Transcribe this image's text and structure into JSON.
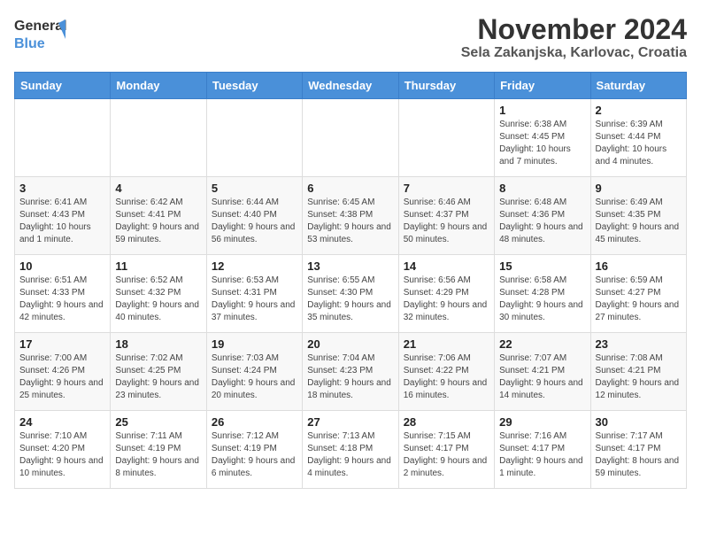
{
  "logo": {
    "general": "General",
    "blue": "Blue"
  },
  "title": "November 2024",
  "subtitle": "Sela Zakanjska, Karlovac, Croatia",
  "headers": [
    "Sunday",
    "Monday",
    "Tuesday",
    "Wednesday",
    "Thursday",
    "Friday",
    "Saturday"
  ],
  "weeks": [
    [
      {
        "day": "",
        "info": ""
      },
      {
        "day": "",
        "info": ""
      },
      {
        "day": "",
        "info": ""
      },
      {
        "day": "",
        "info": ""
      },
      {
        "day": "",
        "info": ""
      },
      {
        "day": "1",
        "info": "Sunrise: 6:38 AM\nSunset: 4:45 PM\nDaylight: 10 hours and 7 minutes."
      },
      {
        "day": "2",
        "info": "Sunrise: 6:39 AM\nSunset: 4:44 PM\nDaylight: 10 hours and 4 minutes."
      }
    ],
    [
      {
        "day": "3",
        "info": "Sunrise: 6:41 AM\nSunset: 4:43 PM\nDaylight: 10 hours and 1 minute."
      },
      {
        "day": "4",
        "info": "Sunrise: 6:42 AM\nSunset: 4:41 PM\nDaylight: 9 hours and 59 minutes."
      },
      {
        "day": "5",
        "info": "Sunrise: 6:44 AM\nSunset: 4:40 PM\nDaylight: 9 hours and 56 minutes."
      },
      {
        "day": "6",
        "info": "Sunrise: 6:45 AM\nSunset: 4:38 PM\nDaylight: 9 hours and 53 minutes."
      },
      {
        "day": "7",
        "info": "Sunrise: 6:46 AM\nSunset: 4:37 PM\nDaylight: 9 hours and 50 minutes."
      },
      {
        "day": "8",
        "info": "Sunrise: 6:48 AM\nSunset: 4:36 PM\nDaylight: 9 hours and 48 minutes."
      },
      {
        "day": "9",
        "info": "Sunrise: 6:49 AM\nSunset: 4:35 PM\nDaylight: 9 hours and 45 minutes."
      }
    ],
    [
      {
        "day": "10",
        "info": "Sunrise: 6:51 AM\nSunset: 4:33 PM\nDaylight: 9 hours and 42 minutes."
      },
      {
        "day": "11",
        "info": "Sunrise: 6:52 AM\nSunset: 4:32 PM\nDaylight: 9 hours and 40 minutes."
      },
      {
        "day": "12",
        "info": "Sunrise: 6:53 AM\nSunset: 4:31 PM\nDaylight: 9 hours and 37 minutes."
      },
      {
        "day": "13",
        "info": "Sunrise: 6:55 AM\nSunset: 4:30 PM\nDaylight: 9 hours and 35 minutes."
      },
      {
        "day": "14",
        "info": "Sunrise: 6:56 AM\nSunset: 4:29 PM\nDaylight: 9 hours and 32 minutes."
      },
      {
        "day": "15",
        "info": "Sunrise: 6:58 AM\nSunset: 4:28 PM\nDaylight: 9 hours and 30 minutes."
      },
      {
        "day": "16",
        "info": "Sunrise: 6:59 AM\nSunset: 4:27 PM\nDaylight: 9 hours and 27 minutes."
      }
    ],
    [
      {
        "day": "17",
        "info": "Sunrise: 7:00 AM\nSunset: 4:26 PM\nDaylight: 9 hours and 25 minutes."
      },
      {
        "day": "18",
        "info": "Sunrise: 7:02 AM\nSunset: 4:25 PM\nDaylight: 9 hours and 23 minutes."
      },
      {
        "day": "19",
        "info": "Sunrise: 7:03 AM\nSunset: 4:24 PM\nDaylight: 9 hours and 20 minutes."
      },
      {
        "day": "20",
        "info": "Sunrise: 7:04 AM\nSunset: 4:23 PM\nDaylight: 9 hours and 18 minutes."
      },
      {
        "day": "21",
        "info": "Sunrise: 7:06 AM\nSunset: 4:22 PM\nDaylight: 9 hours and 16 minutes."
      },
      {
        "day": "22",
        "info": "Sunrise: 7:07 AM\nSunset: 4:21 PM\nDaylight: 9 hours and 14 minutes."
      },
      {
        "day": "23",
        "info": "Sunrise: 7:08 AM\nSunset: 4:21 PM\nDaylight: 9 hours and 12 minutes."
      }
    ],
    [
      {
        "day": "24",
        "info": "Sunrise: 7:10 AM\nSunset: 4:20 PM\nDaylight: 9 hours and 10 minutes."
      },
      {
        "day": "25",
        "info": "Sunrise: 7:11 AM\nSunset: 4:19 PM\nDaylight: 9 hours and 8 minutes."
      },
      {
        "day": "26",
        "info": "Sunrise: 7:12 AM\nSunset: 4:19 PM\nDaylight: 9 hours and 6 minutes."
      },
      {
        "day": "27",
        "info": "Sunrise: 7:13 AM\nSunset: 4:18 PM\nDaylight: 9 hours and 4 minutes."
      },
      {
        "day": "28",
        "info": "Sunrise: 7:15 AM\nSunset: 4:17 PM\nDaylight: 9 hours and 2 minutes."
      },
      {
        "day": "29",
        "info": "Sunrise: 7:16 AM\nSunset: 4:17 PM\nDaylight: 9 hours and 1 minute."
      },
      {
        "day": "30",
        "info": "Sunrise: 7:17 AM\nSunset: 4:17 PM\nDaylight: 8 hours and 59 minutes."
      }
    ]
  ]
}
